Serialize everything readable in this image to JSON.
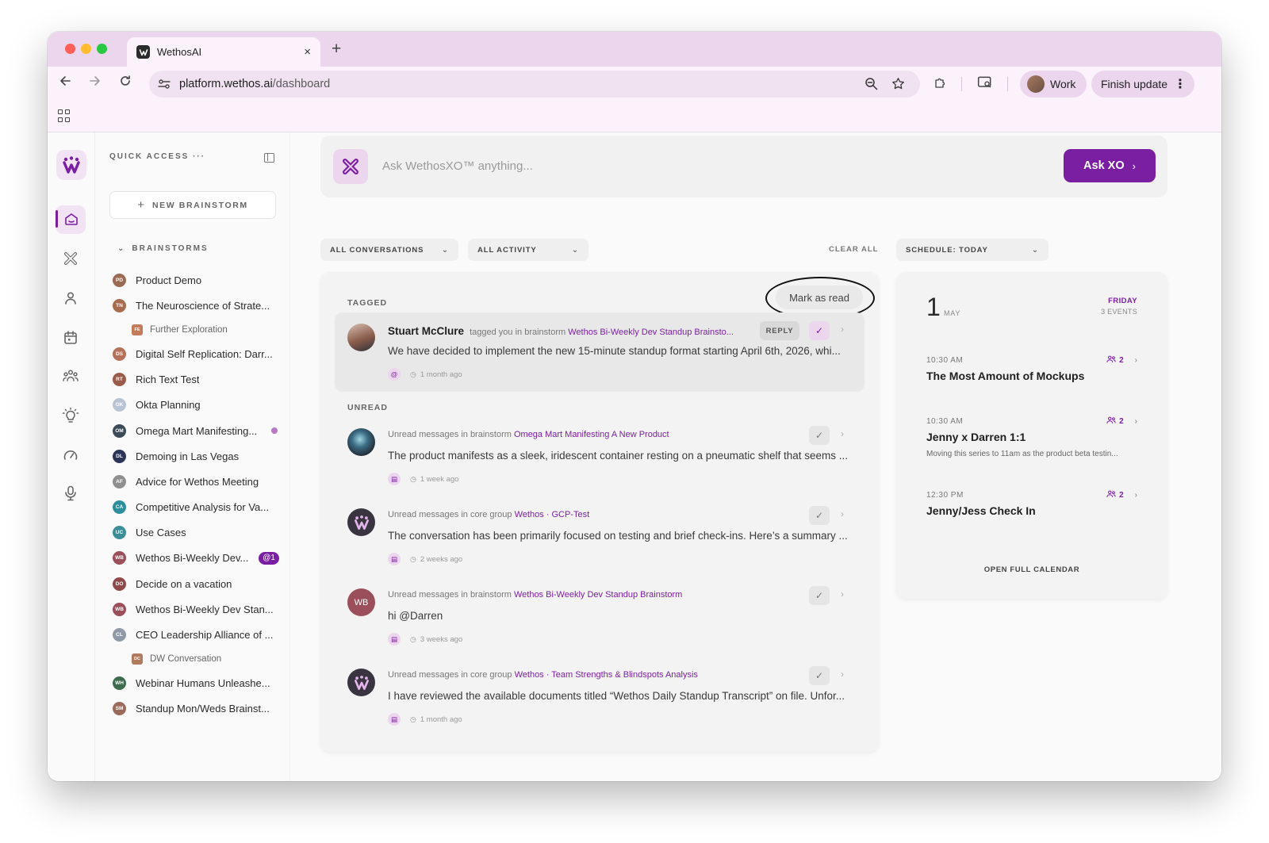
{
  "browser": {
    "tab_title": "WethosAI",
    "tab_close": "×",
    "new_tab": "+",
    "url_host": "platform.wethos.ai",
    "url_path": "/dashboard",
    "profile_name": "Work",
    "update_label": "Finish update"
  },
  "sidebar": {
    "quick_access": "QUICK ACCESS",
    "quick_access_more": "···",
    "new_brainstorm": "NEW BRAINSTORM",
    "brainstorms_header": "BRAINSTORMS",
    "items": [
      {
        "label": "Product Demo",
        "initials": "PD",
        "color": "#9a6a55"
      },
      {
        "label": "The Neuroscience of Strate...",
        "initials": "TN",
        "color": "#a86b4e"
      },
      {
        "label": "Further Exploration",
        "initials": "FE",
        "color": "#c27c5b",
        "sub": true
      },
      {
        "label": "Digital Self Replication: Darr...",
        "initials": "DS",
        "color": "#b5715a"
      },
      {
        "label": "Rich Text Test",
        "initials": "RT",
        "color": "#9b5b4b"
      },
      {
        "label": "Okta Planning",
        "initials": "OK",
        "color": "#b8c3d3"
      },
      {
        "label": "Omega Mart Manifesting...",
        "initials": "OM",
        "color": "#3a4a57",
        "dot": true
      },
      {
        "label": "Demoing in Las Vegas",
        "initials": "DL",
        "color": "#2c3557"
      },
      {
        "label": "Advice for Wethos Meeting",
        "initials": "AF",
        "color": "#8f8f8f"
      },
      {
        "label": "Competitive Analysis for Va...",
        "initials": "CA",
        "color": "#2e8f9c"
      },
      {
        "label": "Use Cases",
        "initials": "UC",
        "color": "#3b8e98"
      },
      {
        "label": "Wethos Bi-Weekly Dev...",
        "initials": "WB",
        "color": "#9b4f5a",
        "badge": "@1"
      },
      {
        "label": "Decide on a vacation",
        "initials": "DO",
        "color": "#8e4a4a"
      },
      {
        "label": "Wethos Bi-Weekly Dev Stan...",
        "initials": "WB",
        "color": "#9b4f5a"
      },
      {
        "label": "CEO Leadership Alliance of ...",
        "initials": "CL",
        "color": "#8f9aa6"
      },
      {
        "label": "DW Conversation",
        "initials": "DC",
        "color": "#b07a5e",
        "sub": true
      },
      {
        "label": "Webinar Humans Unleashe...",
        "initials": "WH",
        "color": "#3e6c4e"
      },
      {
        "label": "Standup Mon/Weds Brainst...",
        "initials": "SM",
        "color": "#9b6a5a"
      }
    ]
  },
  "ask": {
    "placeholder": "Ask WethosXO™ anything...",
    "button": "Ask XO"
  },
  "filters": {
    "conversations": "ALL CONVERSATIONS",
    "activity": "ALL ACTIVITY",
    "clear_all": "CLEAR ALL",
    "schedule": "SCHEDULE: TODAY"
  },
  "feed": {
    "tagged_label": "TAGGED",
    "unread_label": "UNREAD",
    "mark_as_read": "Mark as read",
    "reply": "REPLY",
    "tagged": {
      "who": "Stuart McClure",
      "action": "tagged you in brainstorm",
      "link": "Wethos Bi-Weekly Dev Standup Brainsto...",
      "body": "We have decided to implement the new 15-minute standup format starting April 6th, 2026, whi...",
      "kind": "@",
      "time": "1 month ago"
    },
    "unread": [
      {
        "prefix": "Unread messages in brainstorm",
        "link": "Omega Mart Manifesting A New Product",
        "body": "The product manifests as a sleek, iridescent container resting on a pneumatic shelf that seems ...",
        "time": "1 week ago",
        "avatar": "omega"
      },
      {
        "prefix": "Unread messages in core group",
        "link": "Wethos · GCP-Test",
        "body": "The conversation has been primarily focused on testing and brief check-ins. Here’s a summary ...",
        "time": "2 weeks ago",
        "avatar": "wethos"
      },
      {
        "prefix": "Unread messages in brainstorm",
        "link": "Wethos Bi-Weekly Dev Standup Brainstorm",
        "body": "hi @Darren",
        "time": "3 weeks ago",
        "avatar": "wb",
        "initials": "WB"
      },
      {
        "prefix": "Unread messages in core group",
        "link": "Wethos · Team Strengths & Blindspots Analysis",
        "body": "I have reviewed the available documents titled “Wethos Daily Standup Transcript” on file. Unfor...",
        "time": "1 month ago",
        "avatar": "wethos"
      }
    ]
  },
  "schedule": {
    "day": "1",
    "month": "MAY",
    "weekday": "FRIDAY",
    "events_count": "3 EVENTS",
    "events": [
      {
        "time": "10:30 AM",
        "title": "The Most Amount of Mockups",
        "desc": "",
        "attendees": "2"
      },
      {
        "time": "10:30 AM",
        "title": "Jenny x Darren 1:1",
        "desc": "Moving this series to 11am as the product beta testin...",
        "attendees": "2"
      },
      {
        "time": "12:30 PM",
        "title": "Jenny/Jess Check In",
        "desc": "",
        "attendees": "2"
      }
    ],
    "open_full_calendar": "OPEN FULL CALENDAR"
  },
  "colors": {
    "accent": "#7b1fa2",
    "accent_soft": "#ecd6ee",
    "chrome": "#ecd6ee"
  }
}
